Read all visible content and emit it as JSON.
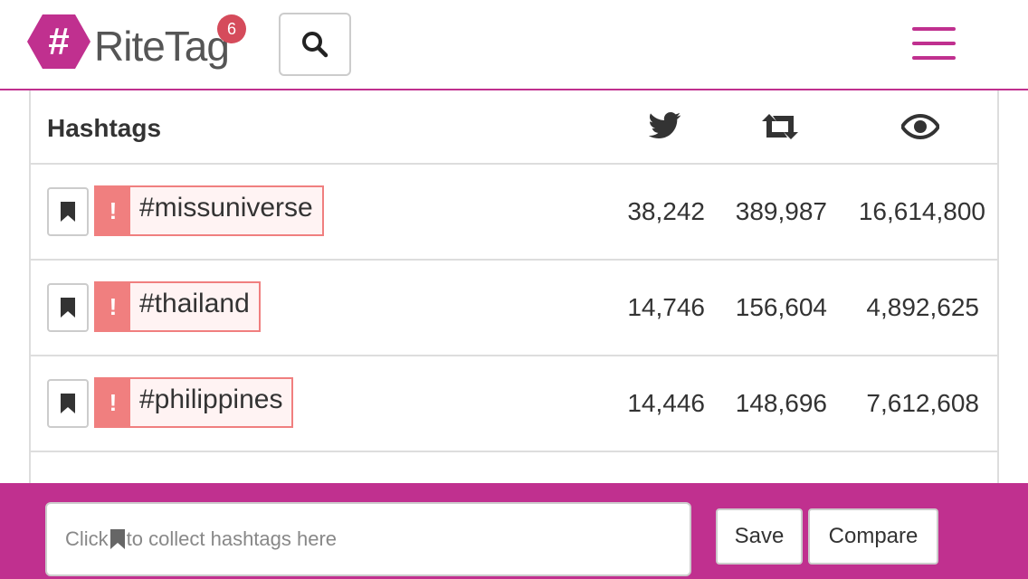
{
  "header": {
    "app_name": "RiteTag",
    "logo_symbol": "#",
    "notification_count": "6",
    "brand_color": "#c0308f",
    "badge_color": "#d54b5b"
  },
  "table": {
    "header_label": "Hashtags",
    "column_icons": [
      "twitter-icon",
      "retweet-icon",
      "eye-icon"
    ],
    "rows": [
      {
        "tag": "#missuniverse",
        "alert": "!",
        "tweets": "38,242",
        "retweets": "389,987",
        "views": "16,614,800"
      },
      {
        "tag": "#thailand",
        "alert": "!",
        "tweets": "14,746",
        "retweets": "156,604",
        "views": "4,892,625"
      },
      {
        "tag": "#philippines",
        "alert": "!",
        "tweets": "14,446",
        "retweets": "148,696",
        "views": "7,612,608"
      }
    ],
    "tag_color": "#f07f7f"
  },
  "footer": {
    "collect_prefix": "Click",
    "collect_suffix": "to collect hashtags here",
    "save_label": "Save",
    "compare_label": "Compare"
  }
}
